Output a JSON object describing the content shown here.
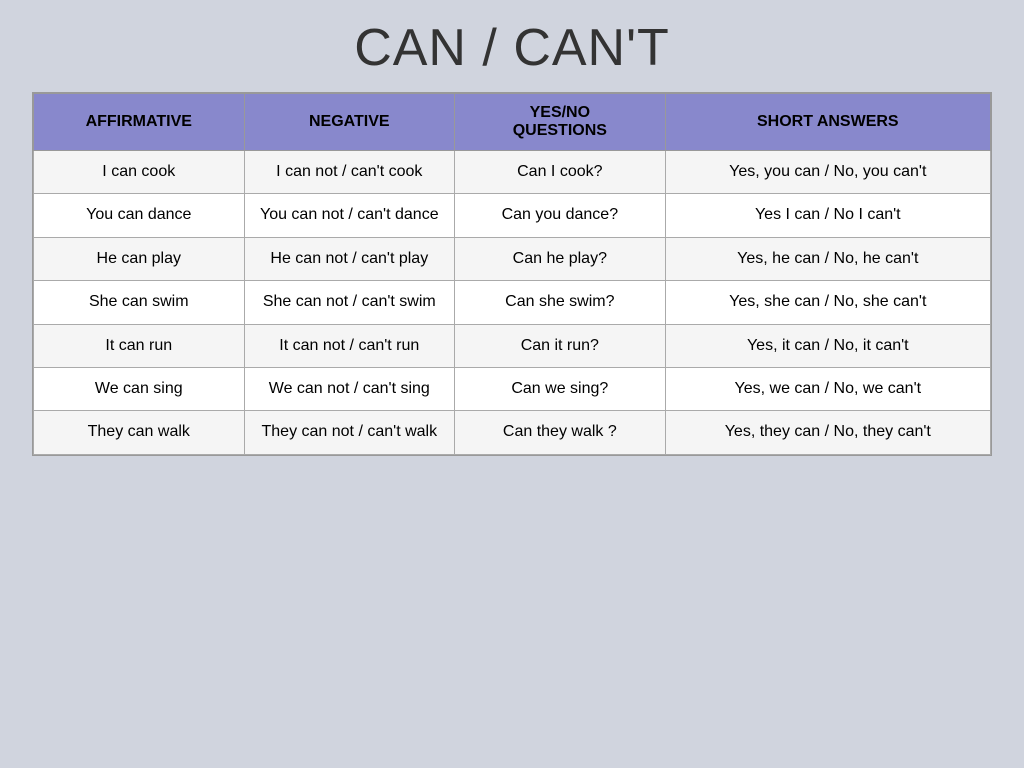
{
  "title": "CAN / CAN'T",
  "table": {
    "headers": [
      "AFFIRMATIVE",
      "NEGATIVE",
      "YES/NO\nQUESTIONS",
      "SHORT ANSWERS"
    ],
    "rows": [
      {
        "affirmative": "I can cook",
        "negative": "I can not  / can't cook",
        "question": "Can I cook?",
        "short": "Yes, you can / No, you can't"
      },
      {
        "affirmative": "You can dance",
        "negative": "You can not / can't dance",
        "question": "Can you dance?",
        "short": "Yes I can /  No I can't"
      },
      {
        "affirmative": "He can play",
        "negative": "He can not / can't play",
        "question": "Can he play?",
        "short": "Yes, he can / No, he can't"
      },
      {
        "affirmative": "She can swim",
        "negative": "She can not / can't swim",
        "question": "Can she swim?",
        "short": "Yes, she can / No, she can't"
      },
      {
        "affirmative": "It can  run",
        "negative": "It can not / can't run",
        "question": "Can it run?",
        "short": "Yes, it can / No, it can't"
      },
      {
        "affirmative": "We can sing",
        "negative": "We can not / can't sing",
        "question": "Can we sing?",
        "short": "Yes, we can / No, we can't"
      },
      {
        "affirmative": "They can walk",
        "negative": "They can not / can't walk",
        "question": "Can they walk ?",
        "short": "Yes, they can / No, they can't"
      }
    ]
  }
}
